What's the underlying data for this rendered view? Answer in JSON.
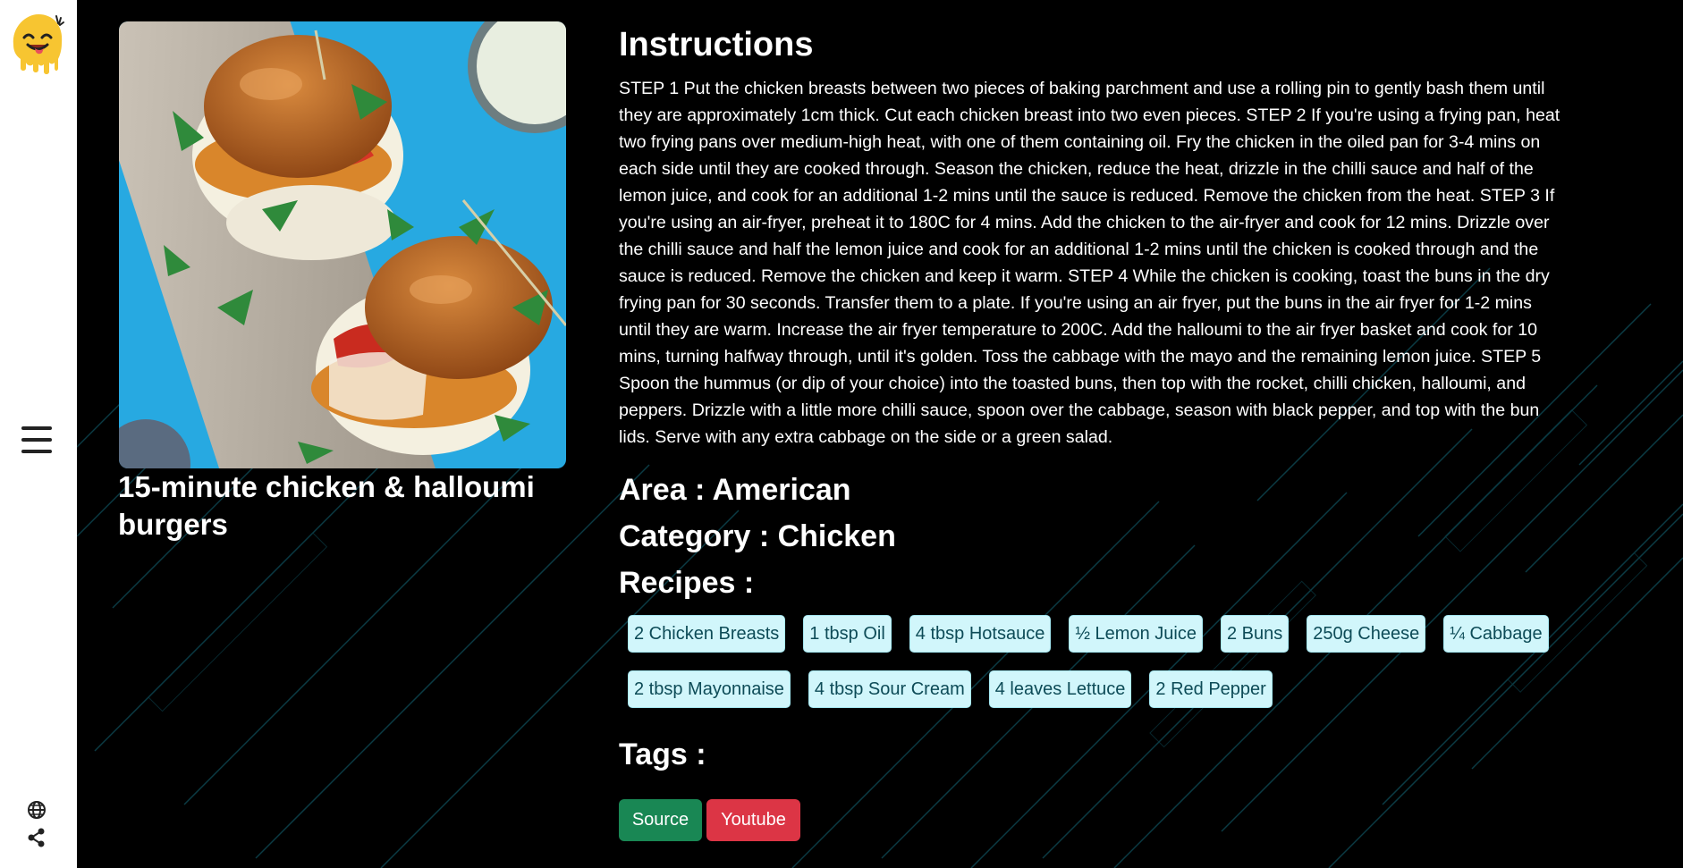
{
  "sidebar": {
    "logo_icon": "smiling-face-logo",
    "menu_icon": "hamburger-menu-icon",
    "globe_icon": "globe-icon",
    "share_icon": "share-icon"
  },
  "meal": {
    "title": "15-minute chicken & halloumi burgers",
    "image_description": "burger-photo"
  },
  "instructions": {
    "heading": "Instructions",
    "text": "STEP 1 Put the chicken breasts between two pieces of baking parchment and use a rolling pin to gently bash them until they are approximately 1cm thick. Cut each chicken breast into two even pieces. STEP 2 If you're using a frying pan, heat two frying pans over medium-high heat, with one of them containing oil. Fry the chicken in the oiled pan for 3-4 mins on each side until they are cooked through. Season the chicken, reduce the heat, drizzle in the chilli sauce and half of the lemon juice, and cook for an additional 1-2 mins until the sauce is reduced. Remove the chicken from the heat. STEP 3 If you're using an air-fryer, preheat it to 180C for 4 mins. Add the chicken to the air-fryer and cook for 12 mins. Drizzle over the chilli sauce and half the lemon juice and cook for an additional 1-2 mins until the chicken is cooked through and the sauce is reduced. Remove the chicken and keep it warm. STEP 4 While the chicken is cooking, toast the buns in the dry frying pan for 30 seconds. Transfer them to a plate. If you're using an air fryer, put the buns in the air fryer for 1-2 mins until they are warm. Increase the air fryer temperature to 200C. Add the halloumi to the air fryer basket and cook for 10 mins, turning halfway through, until it's golden. Toss the cabbage with the mayo and the remaining lemon juice. STEP 5 Spoon the hummus (or dip of your choice) into the toasted buns, then top with the rocket, chilli chicken, halloumi, and peppers. Drizzle with a little more chilli sauce, spoon over the cabbage, season with black pepper, and top with the bun lids. Serve with any extra cabbage on the side or a green salad."
  },
  "area": "Area : American",
  "category": "Category : Chicken",
  "recipes_heading": "Recipes :",
  "ingredients_row1": [
    "2 Chicken Breasts",
    "1 tbsp Oil",
    "4 tbsp Hotsauce",
    "½ Lemon Juice",
    "2 Buns",
    "250g Cheese",
    "¼ Cabbage"
  ],
  "ingredients_row2": [
    "2 tbsp Mayonnaise",
    "4 tbsp Sour Cream",
    "4 leaves Lettuce",
    "2 Red Pepper"
  ],
  "tags_heading": "Tags :",
  "buttons": {
    "source": "Source",
    "youtube": "Youtube"
  },
  "colors": {
    "background": "#000000",
    "sidebar": "#ffffff",
    "chip_bg": "#d1f6fb",
    "chip_text": "#0d4b57",
    "source_button": "#198754",
    "youtube_button": "#dc3545",
    "background_lines": "#0e4a55"
  }
}
